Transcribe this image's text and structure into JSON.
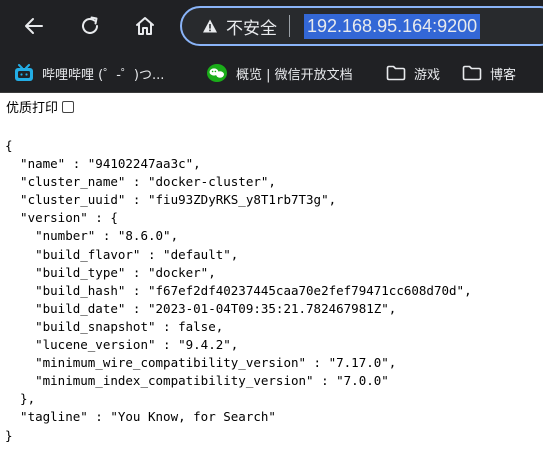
{
  "browser": {
    "security_label": "不安全",
    "url": "192.168.95.164:9200",
    "accent_color": "#8ab4f8",
    "icons": [
      "back-arrow-icon",
      "reload-icon",
      "home-icon",
      "warning-triangle-icon"
    ]
  },
  "bookmarks": {
    "bilibili": "哔哩哔哩 (゜-゜)つ...",
    "wechat": "概览 | 微信开放文档",
    "game": "游戏",
    "blog": "博客"
  },
  "page": {
    "pretty_print_label": "优质打印",
    "pretty_print_checked": false,
    "json_lines": [
      "{",
      "  \"name\" : \"94102247aa3c\",",
      "  \"cluster_name\" : \"docker-cluster\",",
      "  \"cluster_uuid\" : \"fiu93ZDyRKS_y8T1rb7T3g\",",
      "  \"version\" : {",
      "    \"number\" : \"8.6.0\",",
      "    \"build_flavor\" : \"default\",",
      "    \"build_type\" : \"docker\",",
      "    \"build_hash\" : \"f67ef2df40237445caa70e2fef79471cc608d70d\",",
      "    \"build_date\" : \"2023-01-04T09:35:21.782467981Z\",",
      "    \"build_snapshot\" : false,",
      "    \"lucene_version\" : \"9.4.2\",",
      "    \"minimum_wire_compatibility_version\" : \"7.17.0\",",
      "    \"minimum_index_compatibility_version\" : \"7.0.0\"",
      "  },",
      "  \"tagline\" : \"You Know, for Search\"",
      "}"
    ]
  }
}
